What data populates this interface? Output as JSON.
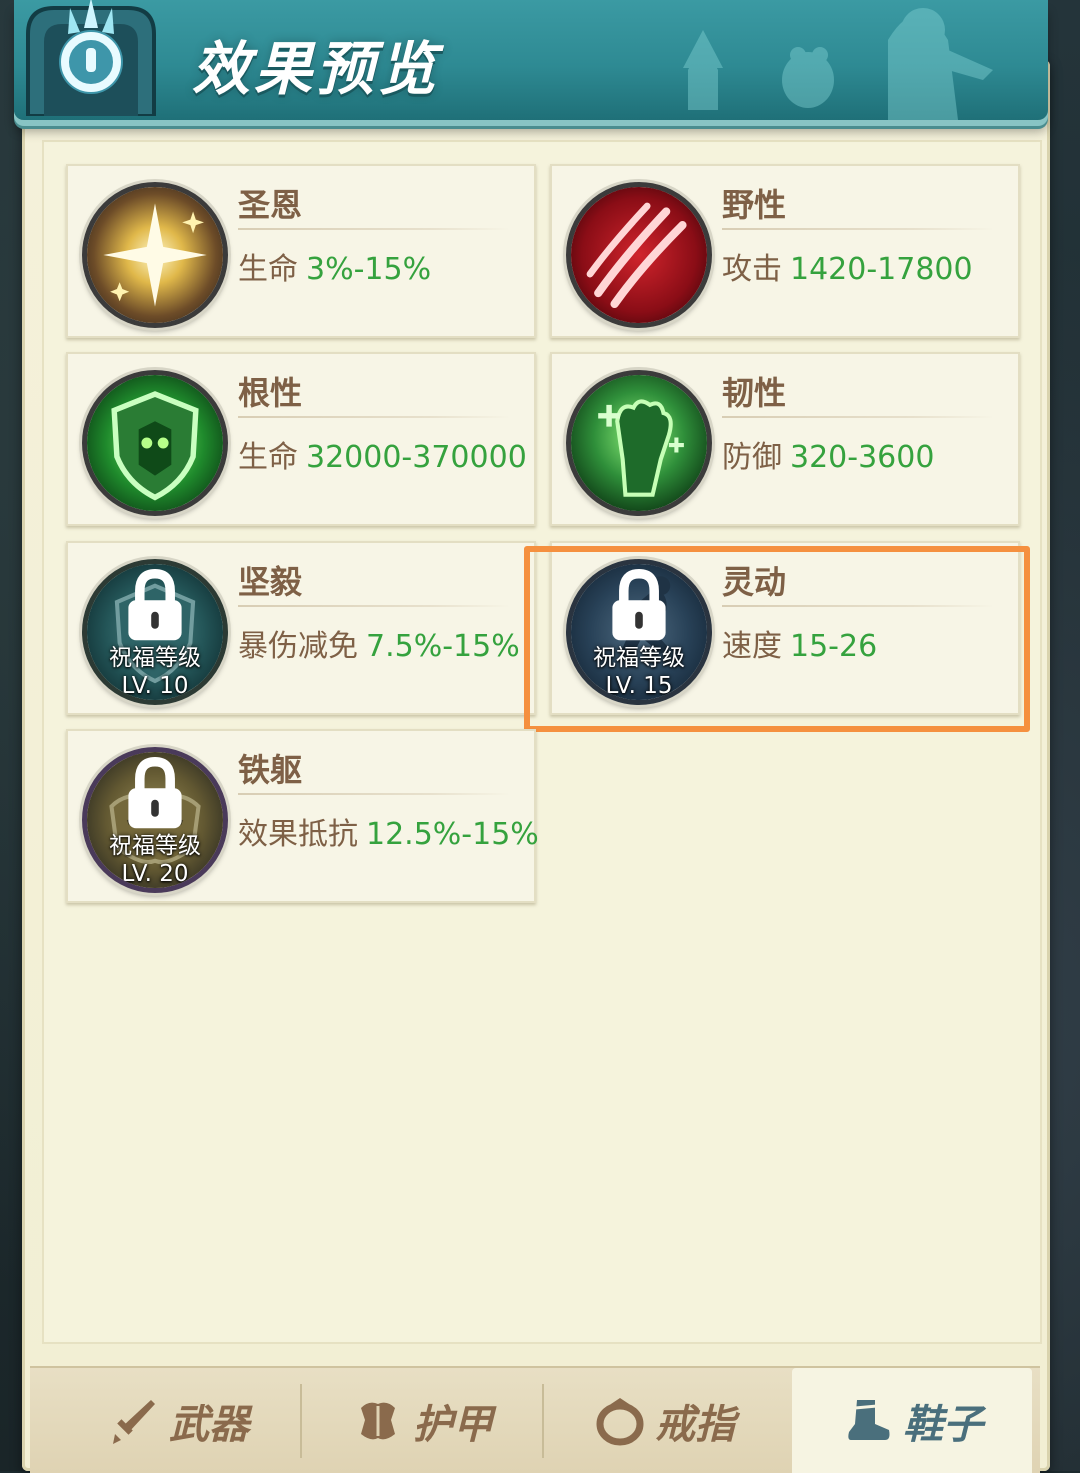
{
  "header": {
    "title": "效果预览",
    "emblem_icon": "blue-shield-emblem-icon"
  },
  "cards": [
    {
      "name": "圣恩",
      "stat_label": "生命",
      "stat_value": "3%-15%",
      "icon": "golden-sparkle-icon",
      "locked": false
    },
    {
      "name": "野性",
      "stat_label": "攻击",
      "stat_value": "1420-17800",
      "icon": "red-claw-icon",
      "locked": false
    },
    {
      "name": "根性",
      "stat_label": "生命",
      "stat_value": "32000-370000",
      "icon": "green-shield-icon",
      "locked": false
    },
    {
      "name": "韧性",
      "stat_label": "防御",
      "stat_value": "320-3600",
      "icon": "green-fist-icon",
      "locked": false
    },
    {
      "name": "坚毅",
      "stat_label": "暴伤减免",
      "stat_value": "7.5%-15%",
      "icon": "teal-shield-icon",
      "locked": true,
      "lock_line1": "祝福等级",
      "lock_line2": "LV. 10"
    },
    {
      "name": "灵动",
      "stat_label": "速度",
      "stat_value": "15-26",
      "icon": "blue-runner-icon",
      "locked": true,
      "lock_line1": "祝福等级",
      "lock_line2": "LV. 15"
    },
    {
      "name": "铁躯",
      "stat_label": "效果抵抗",
      "stat_value": "12.5%-15%",
      "icon": "gold-armor-icon",
      "locked": true,
      "lock_line1": "祝福等级",
      "lock_line2": "LV. 20"
    }
  ],
  "tabs": [
    {
      "label": "武器",
      "icon": "sword-icon",
      "active": false
    },
    {
      "label": "护甲",
      "icon": "armor-icon",
      "active": false
    },
    {
      "label": "戒指",
      "icon": "ring-icon",
      "active": false
    },
    {
      "label": "鞋子",
      "icon": "boot-icon",
      "active": true
    }
  ],
  "colors": {
    "stat_value": "#35a23e",
    "label": "#7e6046",
    "highlight": "#f5903f",
    "header": "#2e8a93"
  }
}
